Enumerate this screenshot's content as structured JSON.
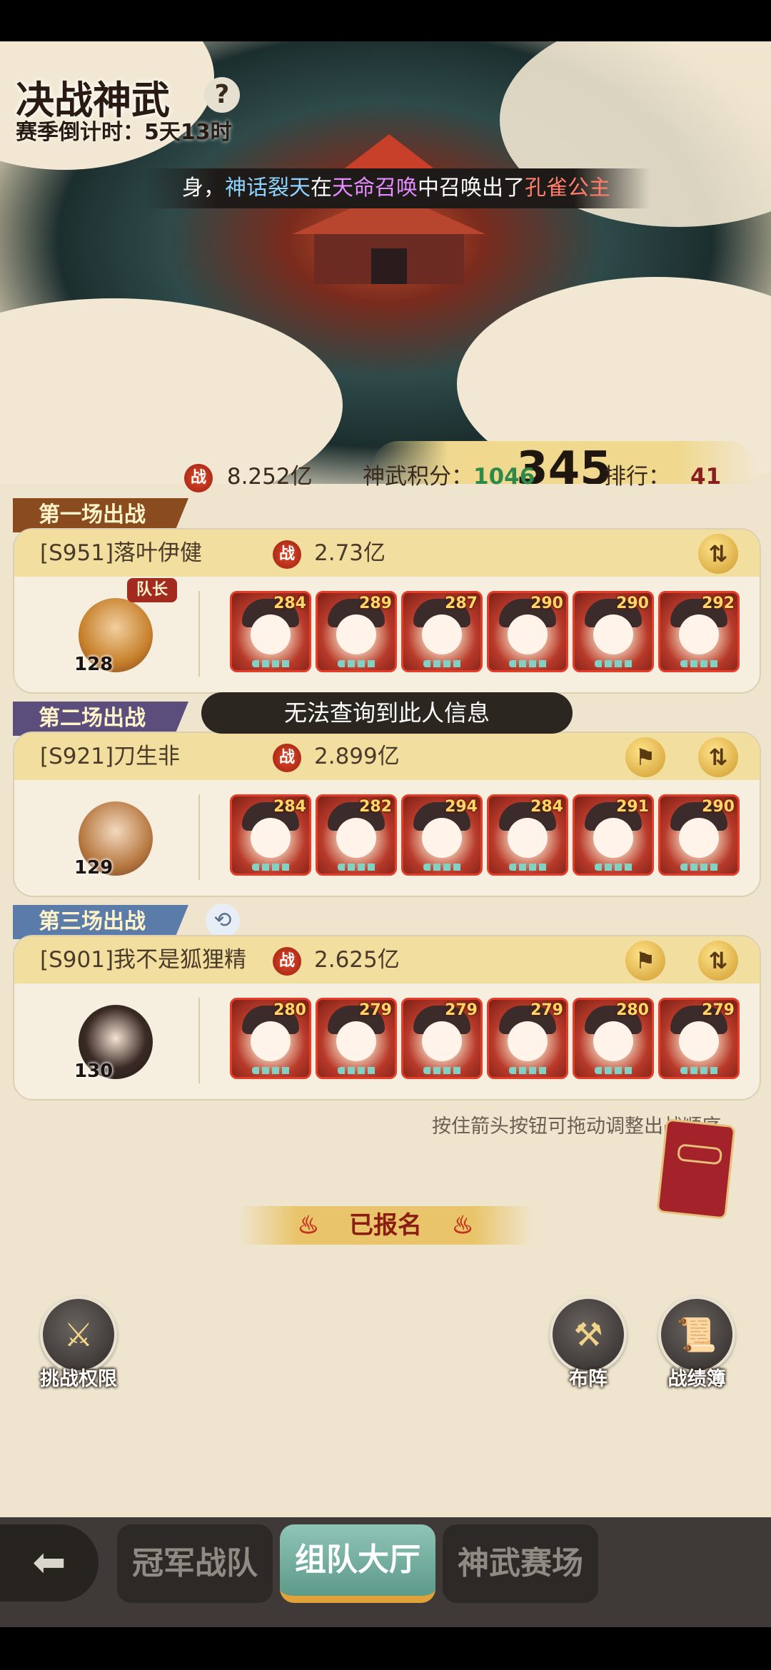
{
  "header": {
    "title": "决战神武",
    "help_icon": "?",
    "countdown": "赛季倒计时：5天13时"
  },
  "ticker": {
    "prefix": "身，",
    "player": "神话裂天",
    "mid1": "在",
    "event": "天命召唤",
    "mid2": "中召唤出了",
    "reward": "孔雀公主"
  },
  "score_display": "345",
  "stats": {
    "power_icon": "战",
    "power": "8.252亿",
    "points_label": "神武积分：",
    "points": "1046",
    "rank_label": "排行：",
    "rank": "41"
  },
  "matches": [
    {
      "ribbon": "第一场出战",
      "name": "[S951]落叶伊健",
      "power_icon": "战",
      "power": "2.73亿",
      "captain_badge": "队长",
      "avatar_level": "128",
      "hero_levels": [
        "284",
        "289",
        "287",
        "290",
        "290",
        "292"
      ]
    },
    {
      "ribbon": "第二场出战",
      "name": "[S921]刀生非",
      "power_icon": "战",
      "power": "2.899亿",
      "avatar_level": "129",
      "hero_levels": [
        "284",
        "282",
        "294",
        "284",
        "291",
        "290"
      ]
    },
    {
      "ribbon": "第三场出战",
      "name": "[S901]我不是狐狸精",
      "power_icon": "战",
      "power": "2.625亿",
      "avatar_level": "130",
      "hero_levels": [
        "280",
        "279",
        "279",
        "279",
        "280",
        "279"
      ]
    }
  ],
  "tooltip": "无法查询到此人信息",
  "hint": "按住箭头按钮可拖动调整出战顺序",
  "registered": "已报名",
  "actions": {
    "challenge": "挑战权限",
    "formation": "布阵",
    "record": "战绩簿"
  },
  "bottom_nav": {
    "back_icon": "arrow-left-icon",
    "tabs": [
      "冠军战队",
      "组队大厅",
      "神武赛场"
    ],
    "active_tab": "组队大厅"
  },
  "colors": {
    "accent_green": "#2f8a4a",
    "rank_red": "#8a1d1d",
    "tab_active": "#5d9a8a"
  }
}
